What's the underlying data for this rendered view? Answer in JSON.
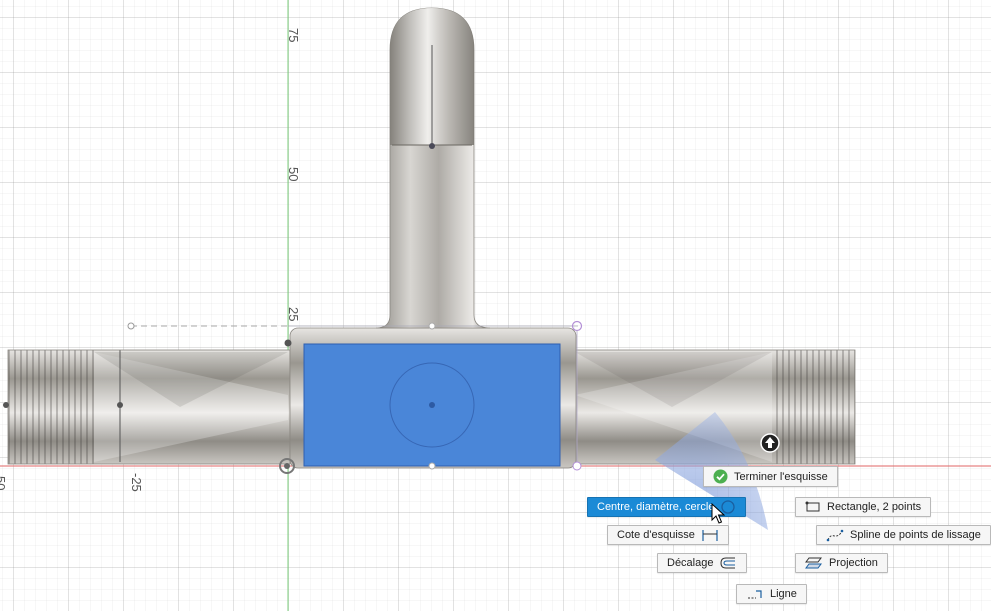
{
  "axis": {
    "x_ticks": [
      "-25",
      "50"
    ],
    "y_ticks": [
      "75",
      "50",
      "25"
    ]
  },
  "marking_menu": {
    "finish_label": "Terminer l'esquisse",
    "circle_label": "Centre, diamètre, cercle",
    "rectangle_label": "Rectangle, 2 points",
    "dimension_label": "Cote d'esquisse",
    "spline_label": "Spline de points de lissage",
    "offset_label": "Décalage",
    "project_label": "Projection",
    "line_label": "Ligne",
    "active_item": "circle"
  },
  "colors": {
    "sketch_profile": "#4a86d8",
    "x_axis": "#e06666",
    "y_axis": "#7ccf7c",
    "menu_highlight": "#1b8ad6",
    "finish_check": "#4caf50"
  },
  "icons": {
    "finish": "check-circle-icon",
    "circle": "circle-icon",
    "rectangle": "rectangle-icon",
    "dimension": "dimension-icon",
    "spline": "spline-icon",
    "offset": "offset-icon",
    "project": "projection-icon",
    "line": "line-icon",
    "cursor": "mouse-pointer-icon",
    "up": "orientation-arrow-icon"
  }
}
